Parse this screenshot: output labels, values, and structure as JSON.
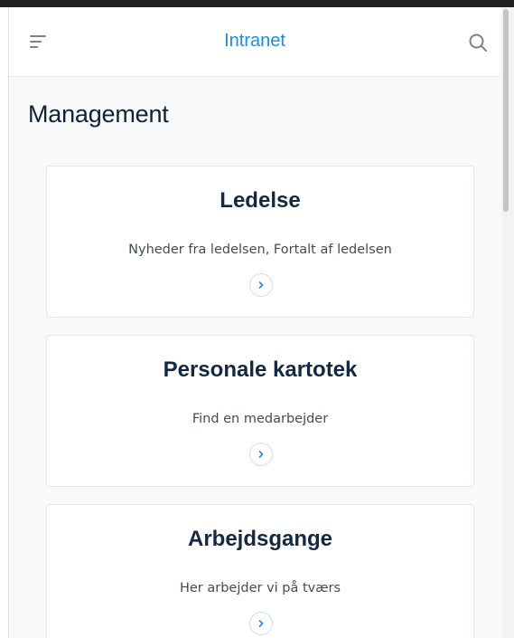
{
  "header": {
    "brand": "Intranet",
    "menu_icon": "menu-icon",
    "search_icon": "search-icon"
  },
  "page": {
    "title": "Management"
  },
  "cards": [
    {
      "title": "Ledelse",
      "description": "Nyheder fra ledelsen, Fortalt af ledelsen",
      "link_icon": "chevron-right-icon"
    },
    {
      "title": "Personale kartotek",
      "description": "Find en medarbejder",
      "link_icon": "chevron-right-icon"
    },
    {
      "title": "Arbejdsgange",
      "description": "Her arbejder vi på tværs",
      "link_icon": "chevron-right-icon"
    }
  ],
  "colors": {
    "accent": "#1a8cf0",
    "heading": "#132843",
    "background": "#f8f9fa"
  }
}
